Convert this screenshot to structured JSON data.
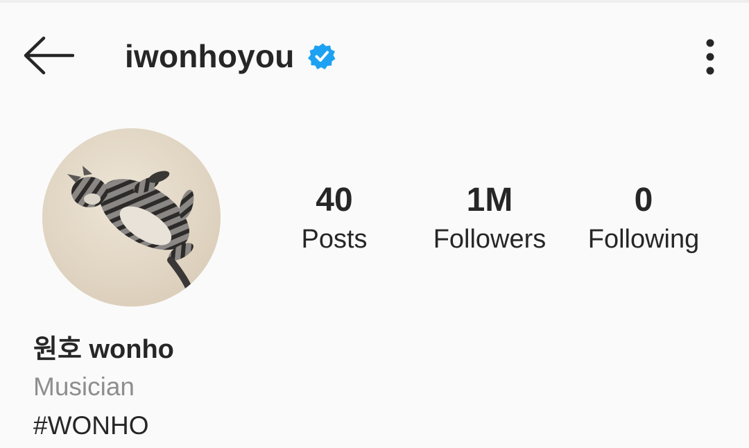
{
  "header": {
    "username": "iwonhoyou",
    "back_icon": "arrow-left-icon",
    "verified_icon": "verified-badge-icon",
    "menu_icon": "more-vertical-icon"
  },
  "stats": {
    "posts": {
      "value": "40",
      "label": "Posts"
    },
    "followers": {
      "value": "1M",
      "label": "Followers"
    },
    "following": {
      "value": "0",
      "label": "Following"
    }
  },
  "bio": {
    "full_name": "원호 wonho",
    "category": "Musician",
    "hashtag": "#WONHO"
  },
  "colors": {
    "background": "#fafafa",
    "text": "#262626",
    "secondary_text": "#8e8e8e",
    "verified_blue": "#1da1f2"
  }
}
